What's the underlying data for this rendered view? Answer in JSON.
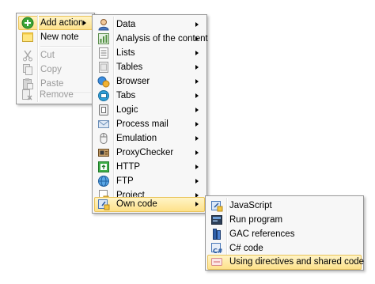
{
  "context_menu": {
    "items": [
      {
        "label": "Add action",
        "icon": "add-circle-icon"
      },
      {
        "label": "New note",
        "icon": "note-icon"
      },
      {
        "label": "Cut",
        "icon": "scissors-icon"
      },
      {
        "label": "Copy",
        "icon": "copy-icon"
      },
      {
        "label": "Paste",
        "icon": "paste-icon"
      },
      {
        "label": "Remove",
        "icon": "remove-icon"
      }
    ]
  },
  "actions_menu": {
    "items": [
      {
        "label": "Data",
        "icon": "user-data-icon"
      },
      {
        "label": "Analysis of the content",
        "icon": "analysis-icon"
      },
      {
        "label": "Lists",
        "icon": "list-icon"
      },
      {
        "label": "Tables",
        "icon": "table-icon"
      },
      {
        "label": "Browser",
        "icon": "browser-icon"
      },
      {
        "label": "Tabs",
        "icon": "tabs-icon"
      },
      {
        "label": "Logic",
        "icon": "logic-icon"
      },
      {
        "label": "Process mail",
        "icon": "mail-icon"
      },
      {
        "label": "Emulation",
        "icon": "mouse-icon"
      },
      {
        "label": "ProxyChecker",
        "icon": "proxy-icon"
      },
      {
        "label": "HTTP",
        "icon": "http-icon"
      },
      {
        "label": "FTP",
        "icon": "ftp-globe-icon"
      },
      {
        "label": "Project",
        "icon": "project-icon"
      },
      {
        "label": "Own code",
        "icon": "code-icon"
      }
    ]
  },
  "own_code_menu": {
    "items": [
      {
        "label": "JavaScript",
        "icon": "javascript-icon"
      },
      {
        "label": "Run program",
        "icon": "run-program-icon"
      },
      {
        "label": "GAC references",
        "icon": "gac-references-icon"
      },
      {
        "label": "C# code",
        "icon": "csharp-icon"
      },
      {
        "label": "Using directives and shared code",
        "icon": "using-directives-icon"
      }
    ]
  },
  "colors": {
    "highlight_top": "#fff4c6",
    "highlight_bottom": "#fde18a",
    "highlight_border": "#e9c35a",
    "menu_background": "#f7f7f7",
    "disabled_text": "#9b9b9b"
  }
}
